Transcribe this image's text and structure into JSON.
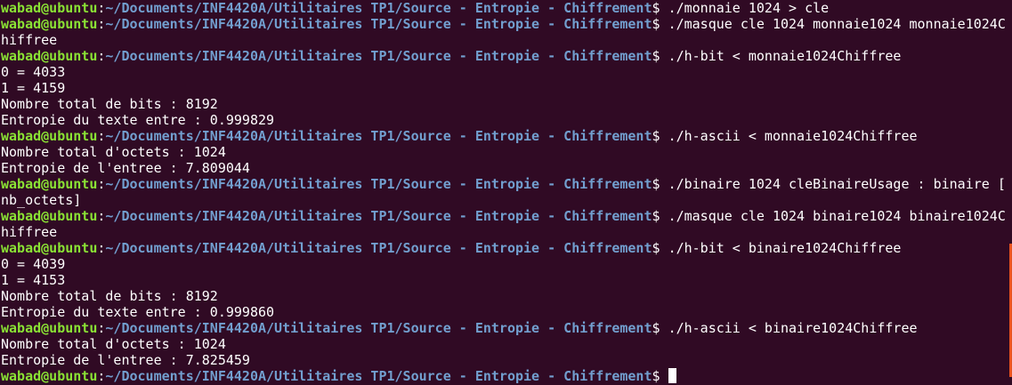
{
  "terminal": {
    "prompt": {
      "user_host": "wabad@ubuntu",
      "colon": ":",
      "path": "~/Documents/INF4420A/Utilitaires TP1/Source - Entropie - Chiffrement",
      "dollar": "$ "
    },
    "lines": [
      {
        "type": "prompt",
        "cmd": "./monnaie 1024 > cle"
      },
      {
        "type": "prompt",
        "cmd": "./masque cle 1024 monnaie1024 monnaie1024C"
      },
      {
        "type": "output",
        "text": "hiffree"
      },
      {
        "type": "prompt",
        "cmd": "./h-bit < monnaie1024Chiffree"
      },
      {
        "type": "output",
        "text": "0 = 4033"
      },
      {
        "type": "output",
        "text": "1 = 4159"
      },
      {
        "type": "output",
        "text": "Nombre total de bits : 8192"
      },
      {
        "type": "output",
        "text": "Entropie du texte entre : 0.999829"
      },
      {
        "type": "prompt",
        "cmd": "./h-ascii < monnaie1024Chiffree"
      },
      {
        "type": "output",
        "text": "Nombre total d'octets : 1024"
      },
      {
        "type": "output",
        "text": "Entropie de l'entree : 7.809044"
      },
      {
        "type": "prompt",
        "cmd": "./binaire 1024 cleBinaireUsage : binaire ["
      },
      {
        "type": "output",
        "text": "nb_octets]"
      },
      {
        "type": "prompt",
        "cmd": "./masque cle 1024 binaire1024 binaire1024C"
      },
      {
        "type": "output",
        "text": "hiffree"
      },
      {
        "type": "prompt",
        "cmd": "./h-bit < binaire1024Chiffree"
      },
      {
        "type": "output",
        "text": "0 = 4039"
      },
      {
        "type": "output",
        "text": "1 = 4153"
      },
      {
        "type": "output",
        "text": "Nombre total de bits : 8192"
      },
      {
        "type": "output",
        "text": "Entropie du texte entre : 0.999860"
      },
      {
        "type": "prompt",
        "cmd": "./h-ascii < binaire1024Chiffree"
      },
      {
        "type": "output",
        "text": "Nombre total d'octets : 1024"
      },
      {
        "type": "output",
        "text": "Entropie de l'entree : 7.825459"
      },
      {
        "type": "prompt",
        "cmd": "",
        "cursor": true
      }
    ],
    "colors": {
      "background": "#300a24",
      "user_host": "#8ae234",
      "path": "#729fcf",
      "text": "#ffffff",
      "scrollbar": "#e95420"
    }
  }
}
